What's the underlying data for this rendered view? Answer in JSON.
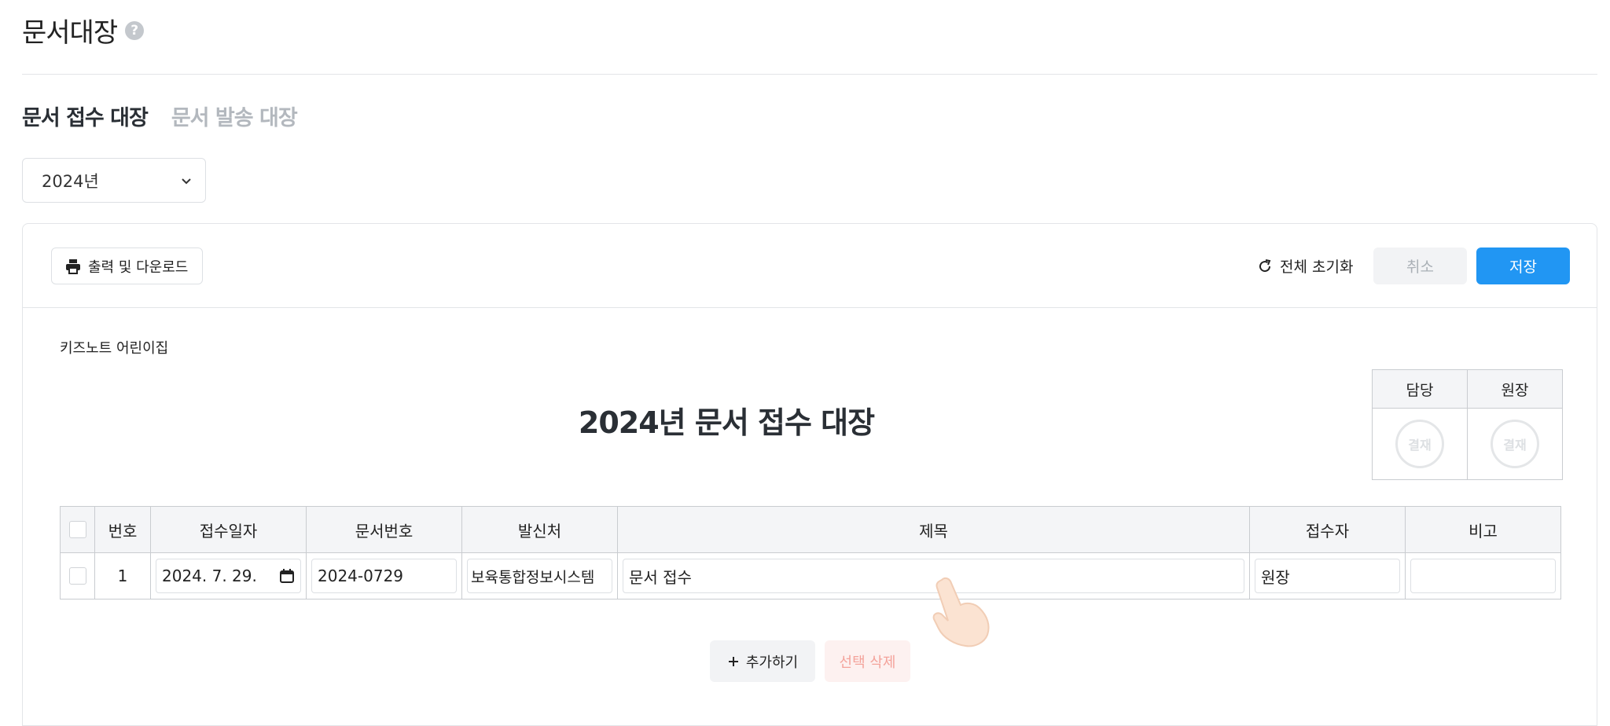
{
  "page": {
    "title": "문서대장",
    "help": "?"
  },
  "tabs": [
    {
      "label": "문서 접수 대장",
      "active": true
    },
    {
      "label": "문서 발송 대장",
      "active": false
    }
  ],
  "year_select": {
    "value": "2024년"
  },
  "toolbar": {
    "print_label": "출력 및 다운로드",
    "reset_label": "전체 초기화",
    "cancel_label": "취소",
    "save_label": "저장"
  },
  "document": {
    "org_name": "키즈노트 어린이집",
    "title": "2024년 문서 접수 대장",
    "approval": {
      "headers": [
        "담당",
        "원장"
      ],
      "stamp_label": "결재"
    }
  },
  "table": {
    "columns": [
      "번호",
      "접수일자",
      "문서번호",
      "발신처",
      "제목",
      "접수자",
      "비고"
    ],
    "rows": [
      {
        "number": "1",
        "date": "2024. 7. 29.",
        "doc_no": "2024-0729",
        "sender": "보육통합정보시스템",
        "subject": "문서 접수",
        "receiver": "원장",
        "note": ""
      }
    ]
  },
  "actions": {
    "add_label": "추가하기",
    "delete_label": "선택 삭제"
  },
  "colors": {
    "primary": "#2196f3",
    "delete_text": "#f4a39b",
    "inactive_tab": "#b3b8be"
  }
}
